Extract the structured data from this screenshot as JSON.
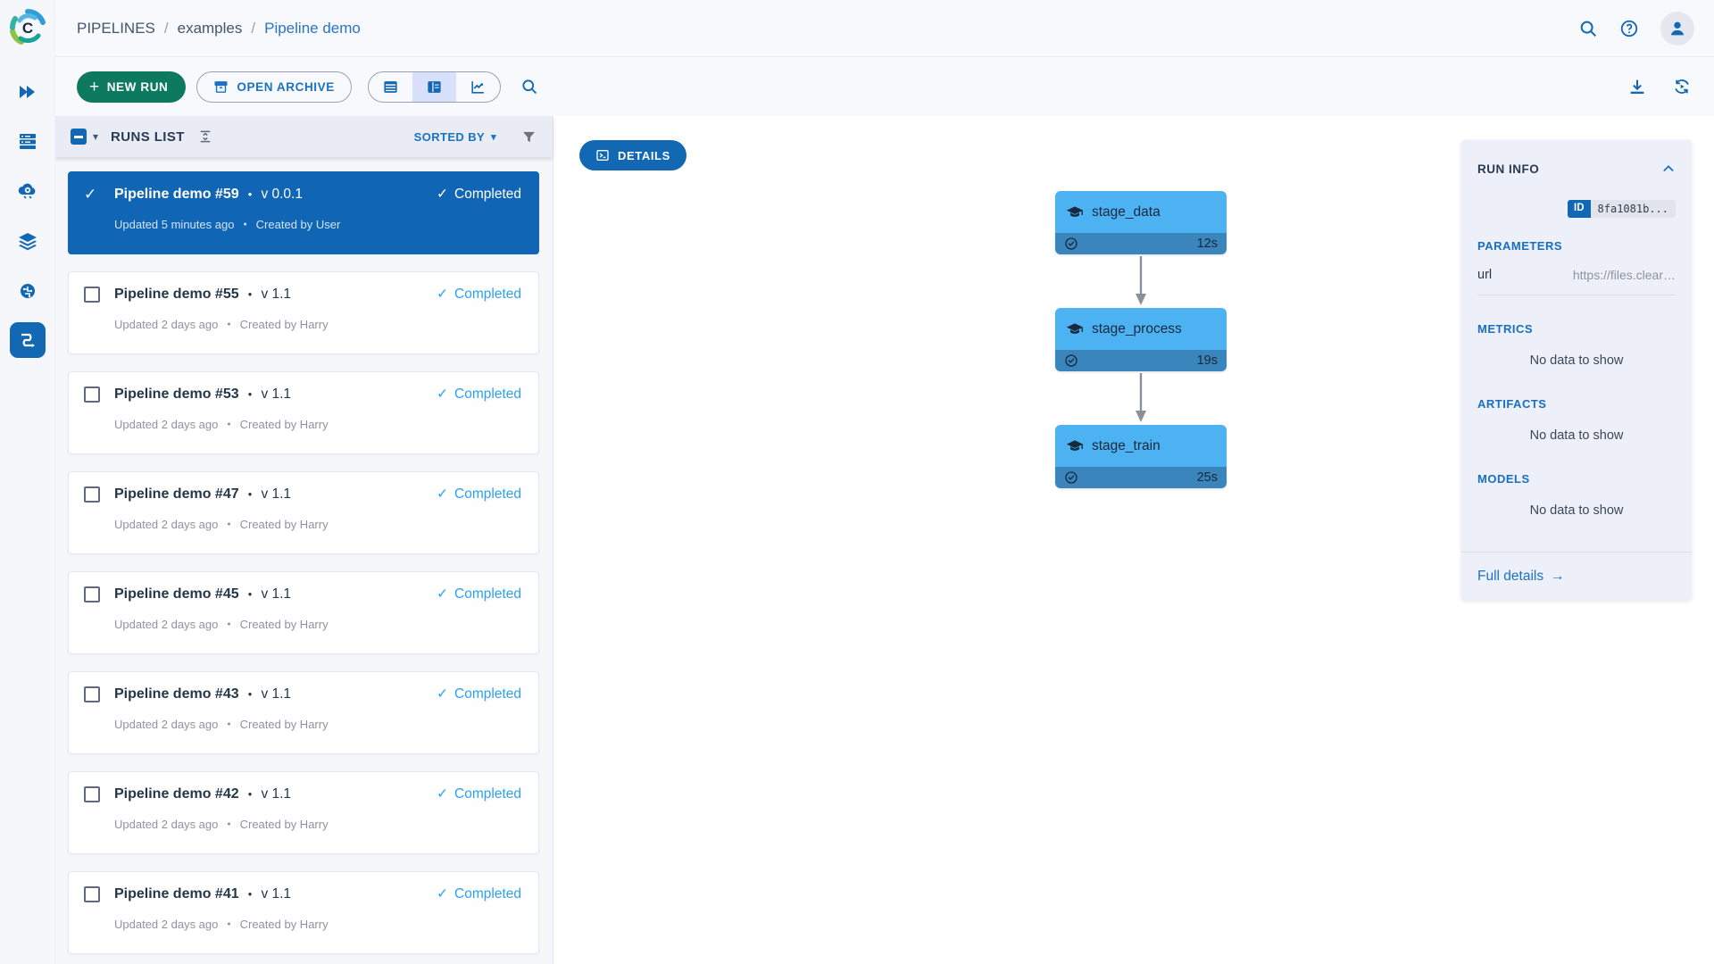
{
  "app": {
    "logo_name": "ClearML"
  },
  "header": {
    "breadcrumb": {
      "root": "PIPELINES",
      "project": "examples",
      "current": "Pipeline demo",
      "separator": "/"
    }
  },
  "toolbar": {
    "new_run_label": "NEW RUN",
    "open_archive_label": "OPEN ARCHIVE",
    "views": [
      "table-view",
      "split-view",
      "chart-view"
    ],
    "selected_view": "split-view"
  },
  "runs_panel": {
    "title": "RUNS LIST",
    "sorted_by_label": "SORTED BY",
    "runs": [
      {
        "name": "Pipeline demo #59",
        "version": "v 0.0.1",
        "status": "Completed",
        "status_check": "✓",
        "updated": "Updated 5 minutes ago",
        "created_by": "Created by User",
        "selected": true
      },
      {
        "name": "Pipeline demo #55",
        "version": "v 1.1",
        "status": "Completed",
        "status_check": "✓",
        "updated": "Updated 2 days ago",
        "created_by": "Created by Harry",
        "selected": false
      },
      {
        "name": "Pipeline demo #53",
        "version": "v 1.1",
        "status": "Completed",
        "status_check": "✓",
        "updated": "Updated 2 days ago",
        "created_by": "Created by Harry",
        "selected": false
      },
      {
        "name": "Pipeline demo #47",
        "version": "v 1.1",
        "status": "Completed",
        "status_check": "✓",
        "updated": "Updated 2 days ago",
        "created_by": "Created by Harry",
        "selected": false
      },
      {
        "name": "Pipeline demo #45",
        "version": "v 1.1",
        "status": "Completed",
        "status_check": "✓",
        "updated": "Updated 2 days ago",
        "created_by": "Created by Harry",
        "selected": false
      },
      {
        "name": "Pipeline demo #43",
        "version": "v 1.1",
        "status": "Completed",
        "status_check": "✓",
        "updated": "Updated 2 days ago",
        "created_by": "Created by Harry",
        "selected": false
      },
      {
        "name": "Pipeline demo #42",
        "version": "v 1.1",
        "status": "Completed",
        "status_check": "✓",
        "updated": "Updated 2 days ago",
        "created_by": "Created by Harry",
        "selected": false
      },
      {
        "name": "Pipeline demo #41",
        "version": "v 1.1",
        "status": "Completed",
        "status_check": "✓",
        "updated": "Updated 2 days ago",
        "created_by": "Created by Harry",
        "selected": false
      }
    ]
  },
  "canvas": {
    "details_label": "DETAILS",
    "dag_nodes": [
      {
        "label": "stage_data",
        "duration": "12s"
      },
      {
        "label": "stage_process",
        "duration": "19s"
      },
      {
        "label": "stage_train",
        "duration": "25s"
      }
    ]
  },
  "run_info": {
    "title": "RUN INFO",
    "id_badge": "ID",
    "id_value": "8fa1081b...",
    "parameters_title": "PARAMETERS",
    "parameters": [
      {
        "key": "url",
        "value": "https://files.clear…"
      }
    ],
    "metrics_title": "METRICS",
    "artifacts_title": "ARTIFACTS",
    "models_title": "MODELS",
    "empty_text": "No data to show",
    "full_details_label": "Full details",
    "full_details_arrow": "→"
  },
  "colors": {
    "accent_blue": "#1268b2",
    "selected_run_blue": "#1065b4",
    "completed_blue": "#2f9ff2",
    "new_run_green": "#0d7a5f",
    "node_top_blue": "#4cb2f2",
    "node_strip_blue": "#3a85bb"
  }
}
